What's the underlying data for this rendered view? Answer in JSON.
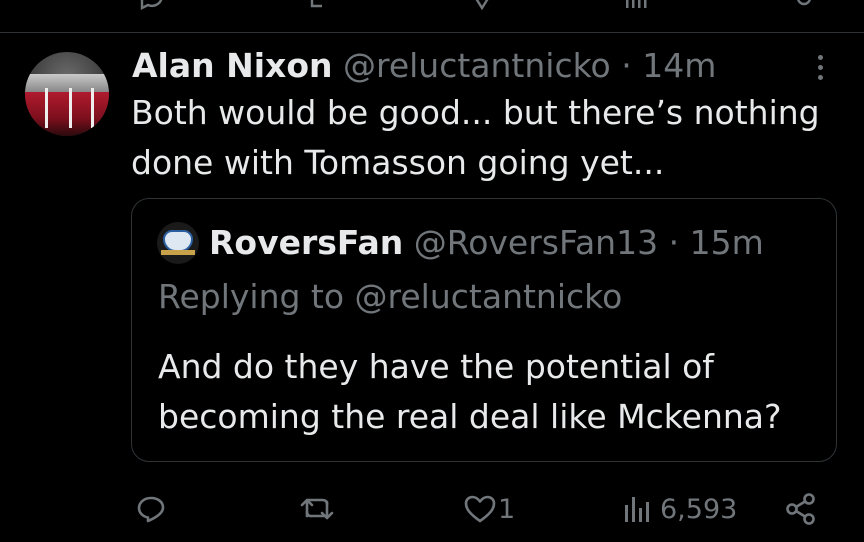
{
  "tweet": {
    "author_name": "Alan Nixon",
    "author_handle": "@reluctantnicko",
    "separator": "·",
    "time": "14m",
    "text": "Both would be good... but there’s nothing done with Tomasson going yet...",
    "more_icon": "more-vertical-icon"
  },
  "quote": {
    "author_name": "RoversFan",
    "author_handle": "@RoversFan13",
    "separator": "·",
    "time": "15m",
    "replying_to": "Replying to @reluctantnicko",
    "text": "And do they have the potential of becoming the real deal like Mckenna?"
  },
  "actions": {
    "reply_icon": "reply-icon",
    "retweet_icon": "retweet-icon",
    "like_icon": "heart-icon",
    "like_count": "1",
    "views_icon": "views-icon",
    "views_count": "6,593",
    "share_icon": "share-icon"
  },
  "colors": {
    "background": "#000000",
    "text": "#e7e9ea",
    "secondary": "#71767b",
    "border": "#2f3336"
  }
}
